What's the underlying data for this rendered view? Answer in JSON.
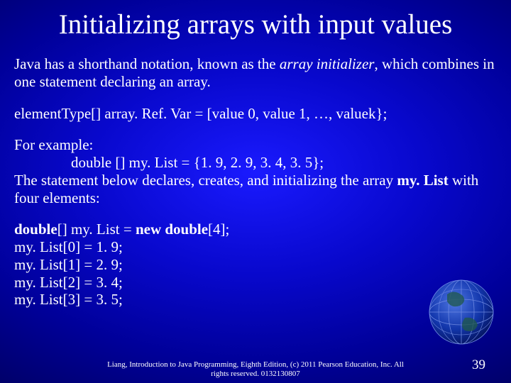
{
  "title": "Initializing arrays with input values",
  "para1_a": "Java has a shorthand notation, known as the ",
  "para1_i": "array initializer",
  "para1_b": ", which combines in one statement declaring an array.",
  "syntax": "elementType[] array. Ref. Var = [value 0, value 1, …, valuek};",
  "ex_label": "For example:",
  "ex_code": "double [] my. List = {1. 9, 2. 9, 3. 4, 3. 5};",
  "para2_a": "The statement below declares, creates, and initializing the array ",
  "para2_b": "my. List",
  "para2_c": " with four elements:",
  "decl_a": "double",
  "decl_b": "[] my. List = ",
  "decl_c": "new double",
  "decl_d": "[4];",
  "l0": "my. List[0] = 1. 9;",
  "l1": "my. List[1] = 2. 9;",
  "l2": "my. List[2] = 3. 4;",
  "l3": "my. List[3] = 3. 5;",
  "footer1": "Liang, Introduction to Java Programming, Eighth Edition, (c) 2011 Pearson Education, Inc. All",
  "footer2": "rights reserved. 0132130807",
  "pagenum": "39"
}
